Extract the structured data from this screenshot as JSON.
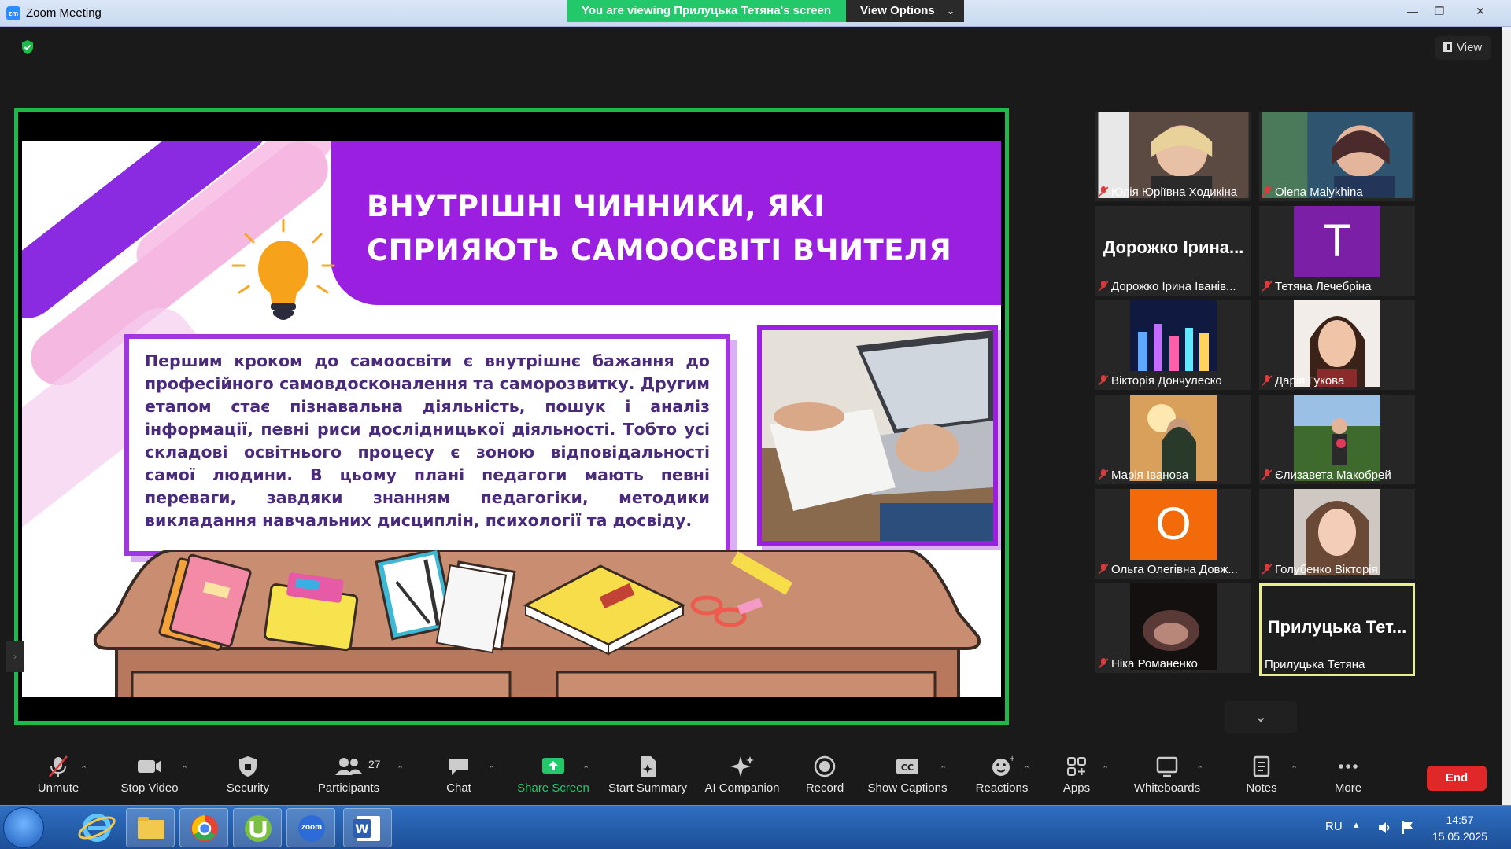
{
  "window": {
    "title": "Zoom Meeting",
    "app_icon": "zm",
    "min": "—",
    "max": "❐",
    "close": "✕"
  },
  "banner": {
    "viewing": "You are viewing Прилуцька Тетяна's screen",
    "view_options": "View Options"
  },
  "top_right": {
    "view_label": "View"
  },
  "slide": {
    "title": "ВНУТРІШНІ ЧИННИКИ, ЯКІ СПРИЯЮТЬ САМООСВІТІ ВЧИТЕЛЯ",
    "body": "Першим кроком до самоосвіти є внутрішнє бажання до професійного самовдосконалення та саморозвитку. Другим етапом стає пізнавальна діяльність, пошук і аналіз інформації, певні риси дослідницької діяльності. Тобто усі складові освітнього процесу є зоною відповідальності самої людини. В цьому плані педагоги мають певні переваги, завдяки знанням педагогіки, методики викладання навчальних дисциплін, психології та досвіду."
  },
  "gallery": [
    {
      "name": "Юлія Юріївна Ходикіна",
      "muted": true
    },
    {
      "name": "Olena Malykhina",
      "muted": true
    },
    {
      "name": "Дорожко Ірина Іванів...",
      "display": "Дорожко Ірина...",
      "muted": true
    },
    {
      "name": "Тетяна Лечебріна",
      "avatar": "T",
      "avatar_color": "#7a1fa6",
      "muted": true
    },
    {
      "name": "Вікторія Дончулеско",
      "muted": true
    },
    {
      "name": "Дарія Гукова",
      "muted": true
    },
    {
      "name": "Марія Іванова",
      "muted": true
    },
    {
      "name": "Єлизавета Макобрей",
      "muted": true
    },
    {
      "name": "Ольга Олегівна Довж...",
      "avatar": "O",
      "avatar_color": "#f26a0a",
      "muted": true
    },
    {
      "name": "Голубенко Вікторія",
      "muted": true
    },
    {
      "name": "Ніка Романенко",
      "muted": true
    },
    {
      "name": "Прилуцька Тетяна",
      "display": "Прилуцька Тет...",
      "muted": false,
      "active": true
    }
  ],
  "toolbar": {
    "unmute": "Unmute",
    "stop_video": "Stop Video",
    "security": "Security",
    "participants": "Participants",
    "participants_count": "27",
    "chat": "Chat",
    "share_screen": "Share Screen",
    "start_summary": "Start Summary",
    "ai_companion": "AI Companion",
    "record": "Record",
    "show_captions": "Show Captions",
    "reactions": "Reactions",
    "apps": "Apps",
    "whiteboards": "Whiteboards",
    "notes": "Notes",
    "more": "More",
    "end": "End"
  },
  "taskbar": {
    "lang": "RU",
    "time": "14:57",
    "date": "15.05.2025",
    "zoom_label": "zoom"
  },
  "colors": {
    "share_border": "#1fb84a",
    "banner_green": "#23c86b",
    "slide_purple": "#9b1fe0",
    "end_red": "#e02828",
    "active_tile": "#e7f08a"
  }
}
